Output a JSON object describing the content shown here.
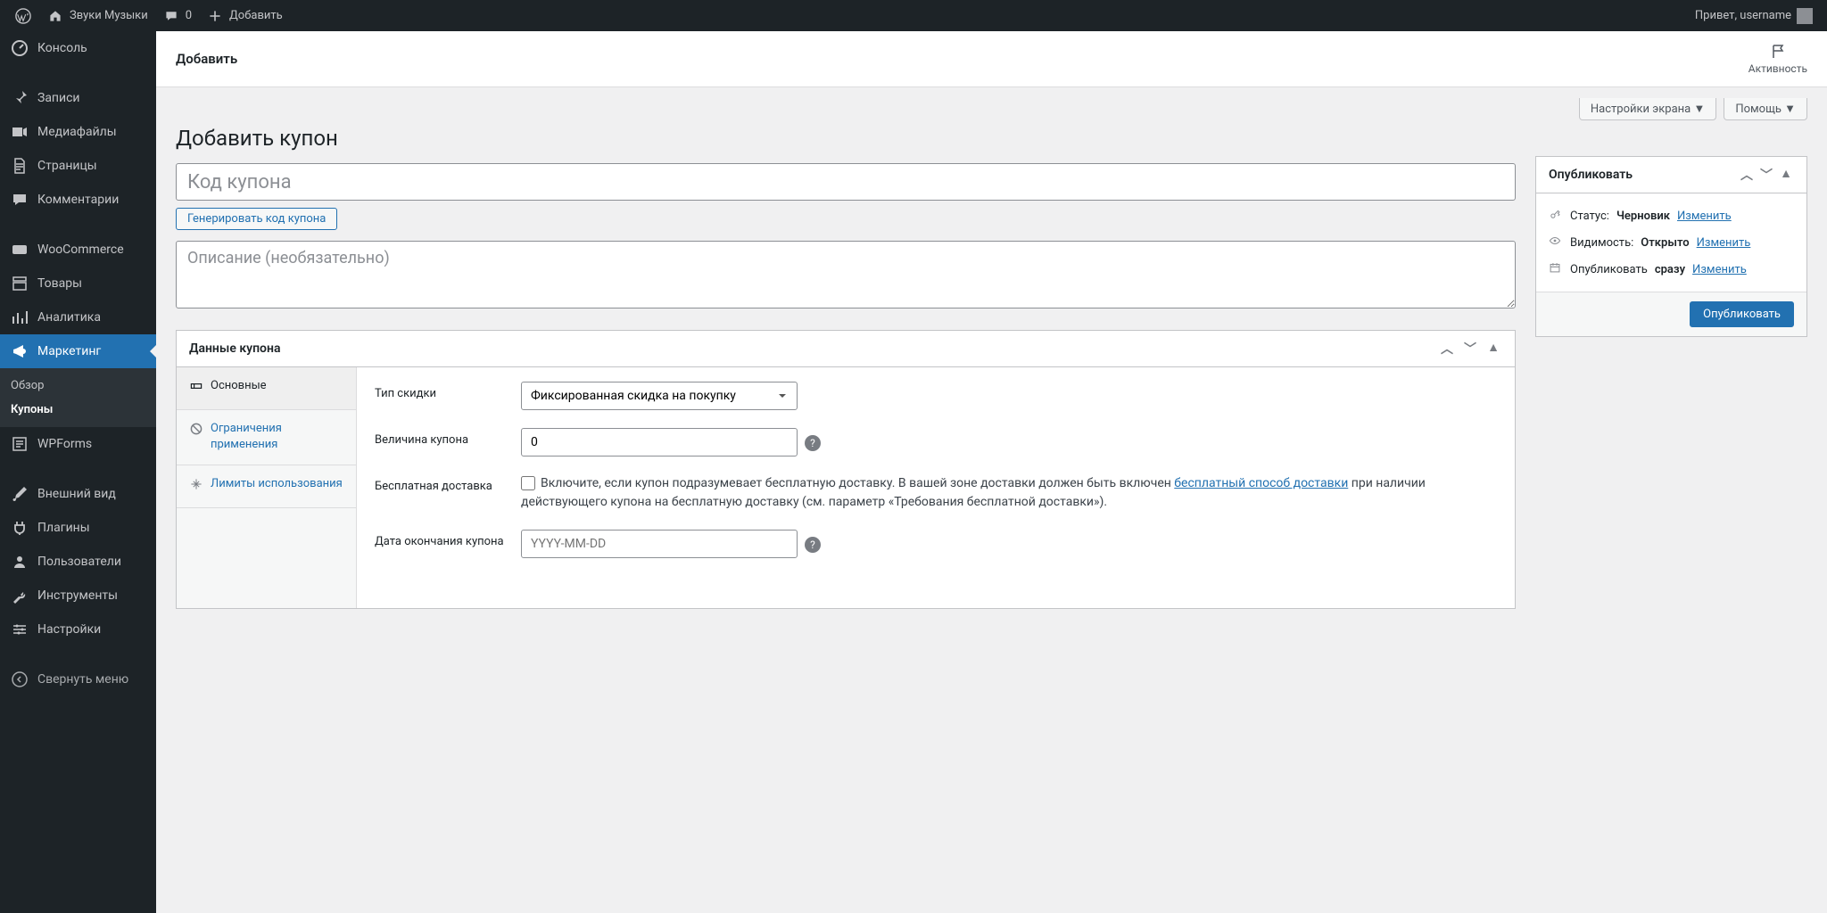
{
  "adminbar": {
    "site_name": "Звуки Музыки",
    "comments": "0",
    "add": "Добавить",
    "greeting": "Привет, username"
  },
  "sidebar": {
    "items": [
      {
        "icon": "dash",
        "label": "Консоль"
      },
      {
        "icon": "pin",
        "label": "Записи"
      },
      {
        "icon": "media",
        "label": "Медиафайлы"
      },
      {
        "icon": "page",
        "label": "Страницы"
      },
      {
        "icon": "comment",
        "label": "Комментарии"
      },
      {
        "icon": "woo",
        "label": "WooCommerce"
      },
      {
        "icon": "product",
        "label": "Товары"
      },
      {
        "icon": "analytics",
        "label": "Аналитика"
      },
      {
        "icon": "marketing",
        "label": "Маркетинг"
      },
      {
        "icon": "wpforms",
        "label": "WPForms"
      },
      {
        "icon": "appearance",
        "label": "Внешний вид"
      },
      {
        "icon": "plugins",
        "label": "Плагины"
      },
      {
        "icon": "users",
        "label": "Пользователи"
      },
      {
        "icon": "tools",
        "label": "Инструменты"
      },
      {
        "icon": "settings",
        "label": "Настройки"
      }
    ],
    "submenu": {
      "overview": "Обзор",
      "coupons": "Купоны"
    },
    "collapse": "Свернуть меню"
  },
  "wc_header": {
    "title": "Добавить",
    "activity": "Активность"
  },
  "screen_opts": {
    "screen": "Настройки экрана",
    "help": "Помощь"
  },
  "page": {
    "title": "Добавить купон",
    "code_placeholder": "Код купона",
    "gen": "Генерировать код купона",
    "desc_placeholder": "Описание (необязательно)"
  },
  "coupon_panel": {
    "title": "Данные купона",
    "tabs": {
      "general": "Основные",
      "restriction": "Ограничения применения",
      "limits": "Лимиты использования"
    },
    "fields": {
      "type_label": "Тип скидки",
      "type_value": "Фиксированная скидка на покупку",
      "amount_label": "Величина купона",
      "amount_value": "0",
      "ship_label": "Бесплатная доставка",
      "ship_text_1": "Включите, если купон подразумевает бесплатную доставку. В вашей зоне доставки должен быть включен ",
      "ship_link": "бесплатный способ доставки",
      "ship_text_2": " при наличии действующего купона на бесплатную доставку (см. параметр «Требования бесплатной доставки»).",
      "expiry_label": "Дата окончания купона",
      "expiry_placeholder": "YYYY-MM-DD"
    }
  },
  "publish": {
    "title": "Опубликовать",
    "status_label": "Статус:",
    "status_value": "Черновик",
    "visibility_label": "Видимость:",
    "visibility_value": "Открыто",
    "schedule_label": "Опубликовать",
    "schedule_value": "сразу",
    "edit": "Изменить",
    "button": "Опубликовать"
  }
}
